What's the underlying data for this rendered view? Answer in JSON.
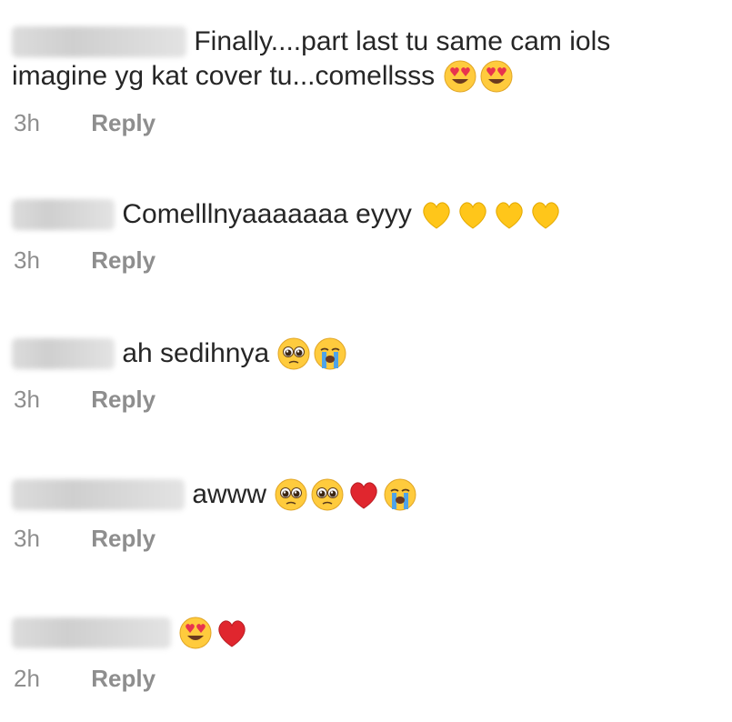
{
  "comments": [
    {
      "text_line1": "Finally....part last tu same cam iols",
      "text_line2": "imagine yg kat cover tu...comellsss",
      "time": "3h",
      "reply": "Reply",
      "emojis": [
        "heart-eyes",
        "heart-eyes"
      ]
    },
    {
      "text": "Comelllnyaaaaaaa eyyy",
      "time": "3h",
      "reply": "Reply",
      "emojis": [
        "yellow-heart",
        "yellow-heart",
        "yellow-heart",
        "yellow-heart"
      ]
    },
    {
      "text": "ah sedihnya",
      "time": "3h",
      "reply": "Reply",
      "emojis": [
        "pleading-face",
        "crying-face"
      ]
    },
    {
      "text": "awww",
      "time": "3h",
      "reply": "Reply",
      "emojis": [
        "pleading-face",
        "pleading-face",
        "red-heart",
        "crying-face"
      ]
    },
    {
      "text": "",
      "time": "2h",
      "reply": "Reply",
      "emojis": [
        "heart-eyes",
        "red-heart"
      ]
    }
  ]
}
